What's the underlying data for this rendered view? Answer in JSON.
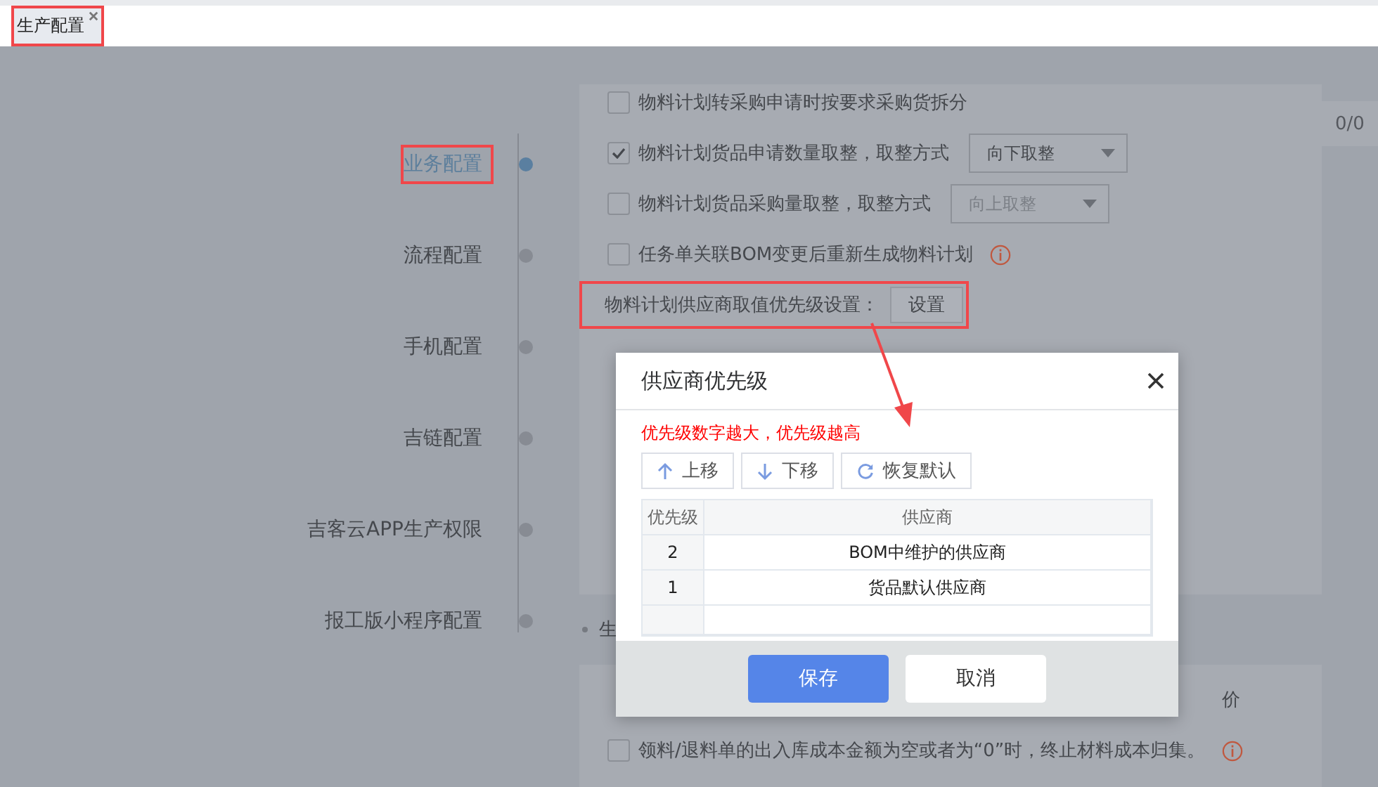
{
  "tab": {
    "label": "生产配置",
    "selected": true,
    "highlighted": true
  },
  "badge": "0/0",
  "nav": [
    {
      "label": "业务配置",
      "selected": true,
      "highlighted": true
    },
    {
      "label": "流程配置",
      "selected": false,
      "highlighted": false
    },
    {
      "label": "手机配置",
      "selected": false,
      "highlighted": false
    },
    {
      "label": "吉链配置",
      "selected": false,
      "highlighted": false
    },
    {
      "label": "吉客云APP生产权限",
      "selected": false,
      "highlighted": false
    },
    {
      "label": "报工版小程序配置",
      "selected": false,
      "highlighted": false
    }
  ],
  "settings": [
    {
      "kind": "checkbox",
      "label": "物料计划转采购申请时按要求采购货拆分",
      "checked": false
    },
    {
      "kind": "select",
      "label": "物料计划货品申请数量取整，取整方式",
      "checked": true,
      "select": "向下取整",
      "disabled": false
    },
    {
      "kind": "select",
      "label": "物料计划货品采购量取整，取整方式",
      "checked": false,
      "select": "向上取整",
      "disabled": true
    },
    {
      "kind": "info",
      "label": "任务单关联BOM变更后重新生成物料计划",
      "checked": false
    },
    {
      "kind": "button",
      "label": "物料计划供应商取值优先级设置：",
      "button": "设置",
      "highlighted": true
    }
  ],
  "section2": {
    "heading": "生",
    "settings": [
      {
        "kind": "tail",
        "label": "价"
      },
      {
        "kind": "info",
        "label": "领料/退料单的出入库成本金额为空或者为“0”时，终止材料成本归集。",
        "checked": false
      }
    ]
  },
  "dialog": {
    "title": "供应商优先级",
    "hint": "优先级数字越大，优先级越高",
    "tools": [
      {
        "kind": "up",
        "label": "上移"
      },
      {
        "kind": "down",
        "label": "下移"
      },
      {
        "kind": "reset",
        "label": "恢复默认"
      }
    ],
    "columns": [
      "优先级",
      "供应商"
    ],
    "rows": [
      [
        "2",
        "BOM中维护的供应商"
      ],
      [
        "1",
        "货品默认供应商"
      ]
    ],
    "buttons": [
      {
        "kind": "primary",
        "label": "保存"
      },
      {
        "kind": "default",
        "label": "取消"
      }
    ]
  }
}
